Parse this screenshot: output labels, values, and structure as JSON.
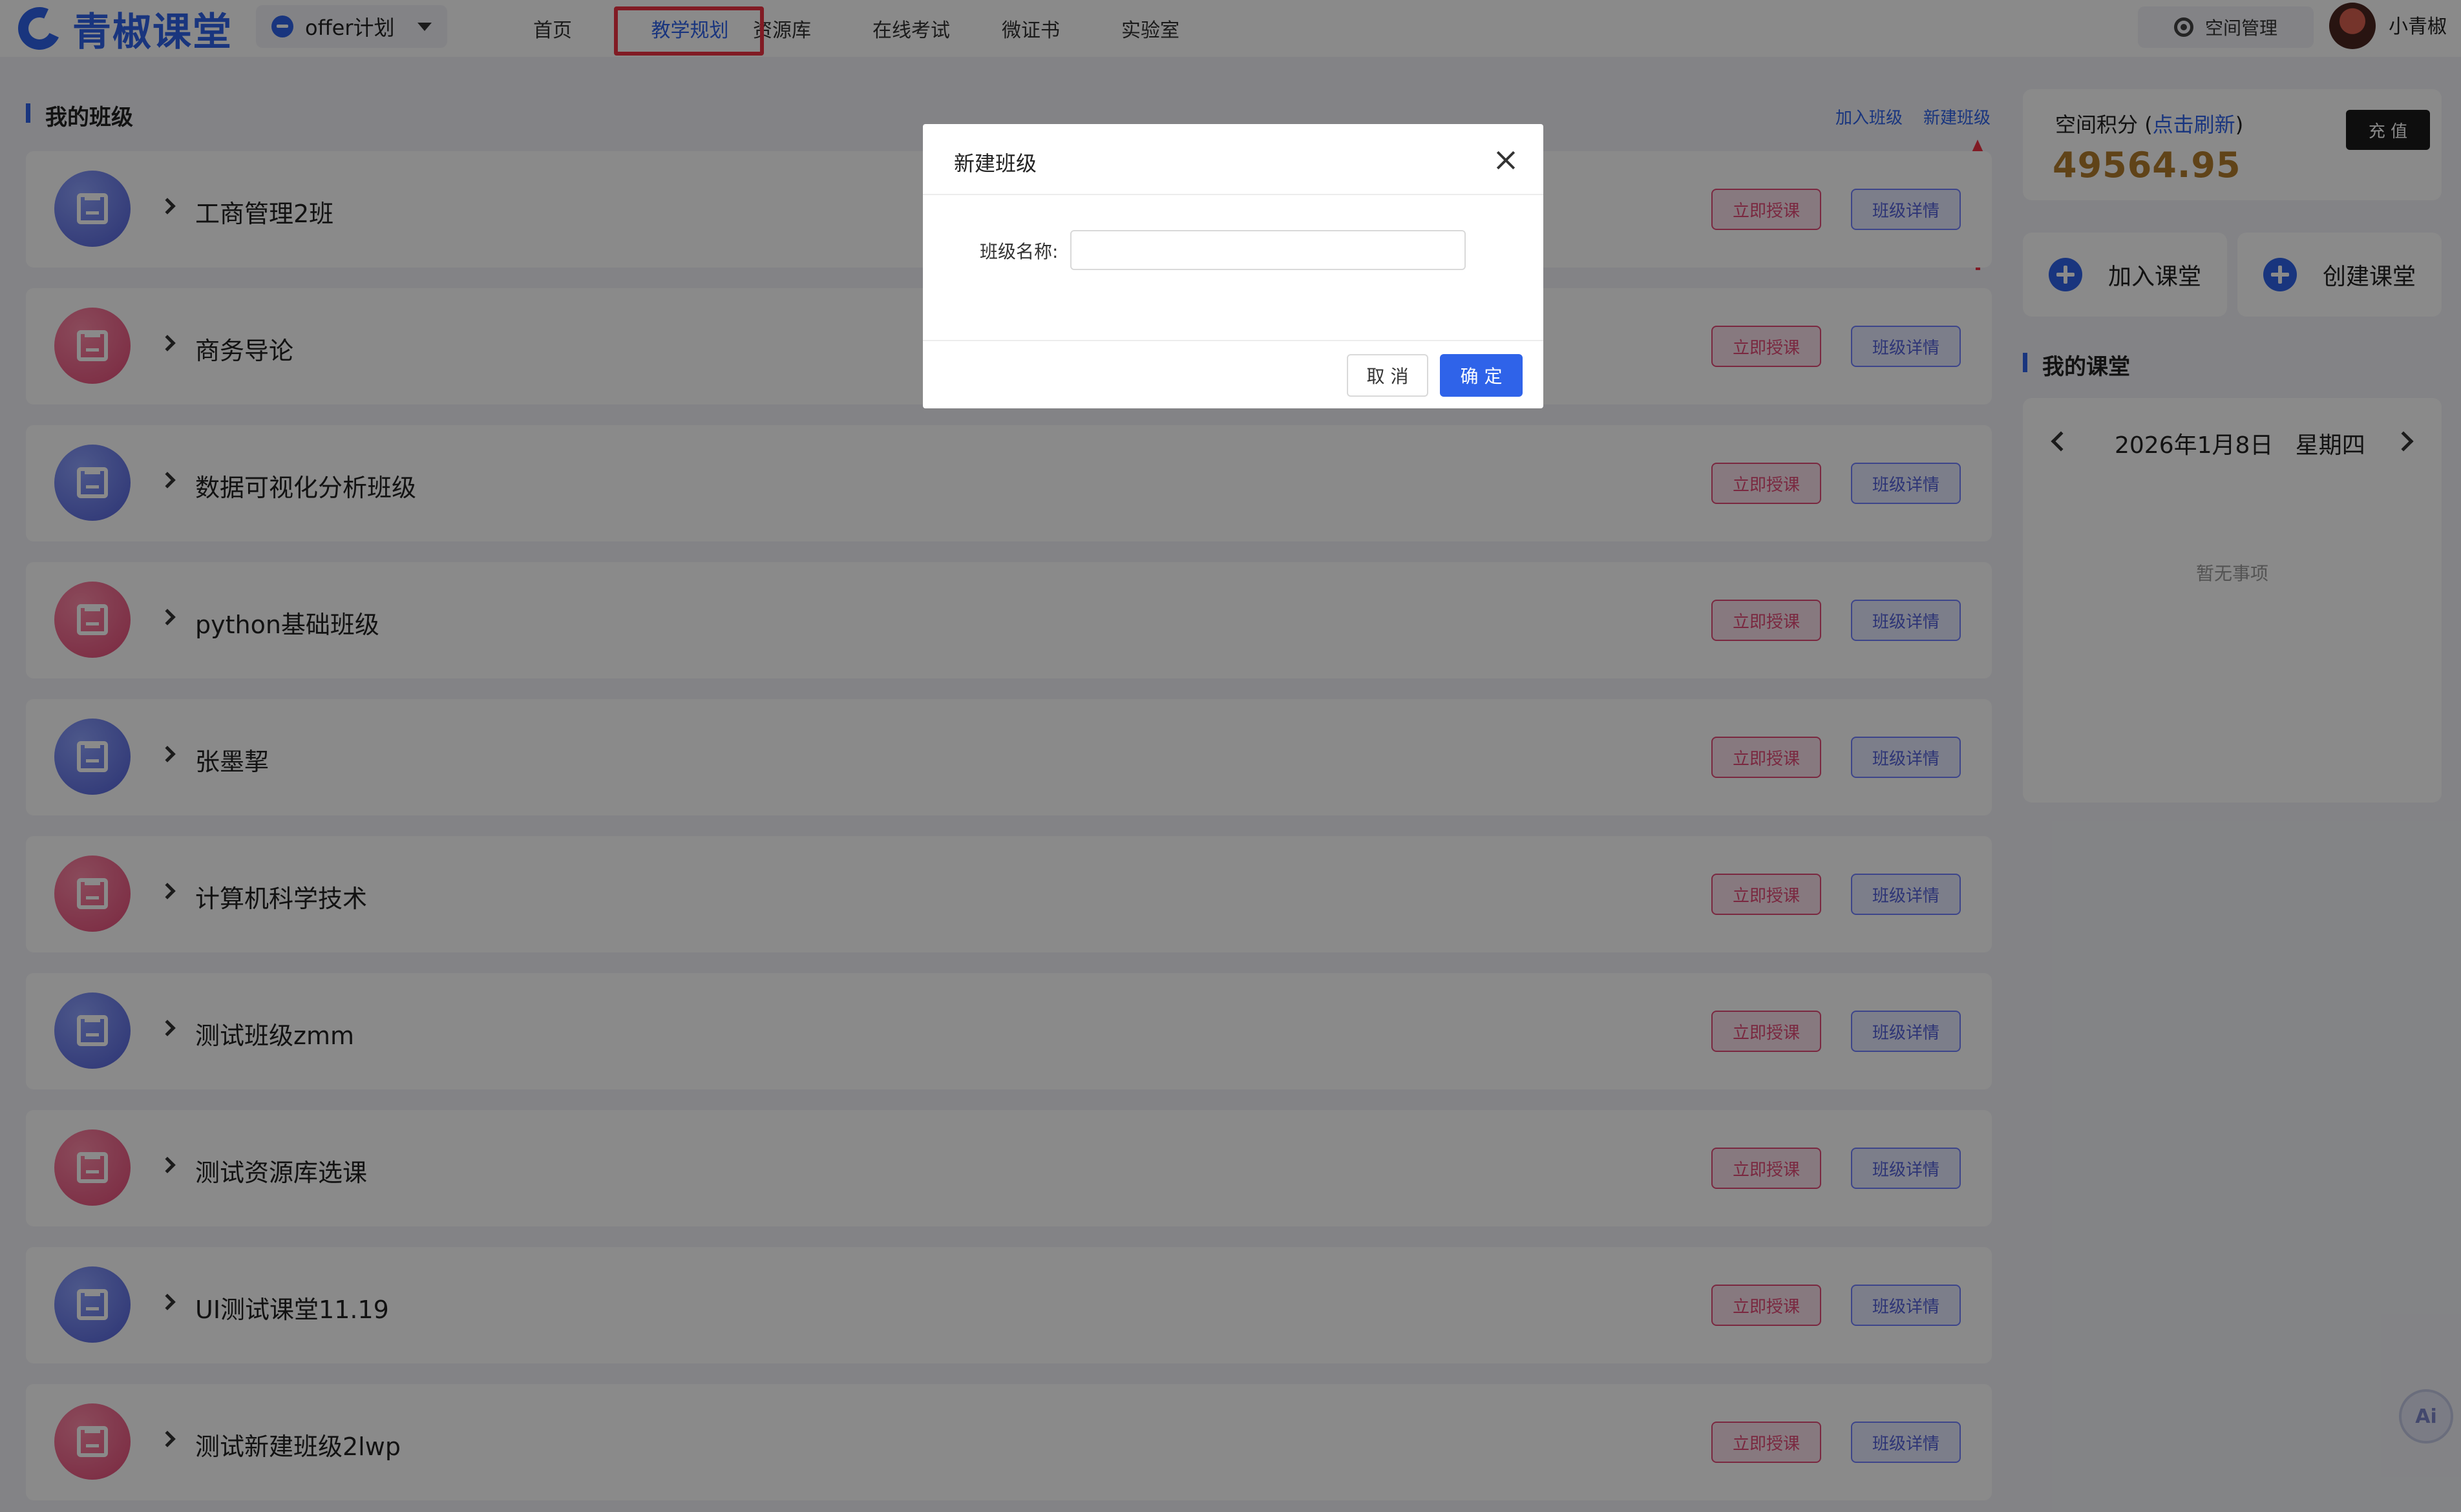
{
  "header": {
    "logo_text": "青椒课堂",
    "plan_selector": "offer计划",
    "nav": [
      "首页",
      "教学规划",
      "资源库",
      "在线考试",
      "微证书",
      "实验室"
    ],
    "active_nav": "教学规划",
    "space_management": "空间管理",
    "user_name": "小青椒"
  },
  "classes": {
    "title": "我的班级",
    "join_link": "加入班级",
    "create_link": "新建班级",
    "teach_button": "立即授课",
    "detail_button": "班级详情",
    "items": [
      {
        "name": "工商管理2班",
        "icon_color": "blue"
      },
      {
        "name": "商务导论",
        "icon_color": "pink"
      },
      {
        "name": "数据可视化分析班级",
        "icon_color": "blue"
      },
      {
        "name": "python基础班级",
        "icon_color": "pink"
      },
      {
        "name": "张墨挈",
        "icon_color": "blue"
      },
      {
        "name": "计算机科学技术",
        "icon_color": "pink"
      },
      {
        "name": "测试班级zmm",
        "icon_color": "blue"
      },
      {
        "name": "测试资源库选课",
        "icon_color": "pink"
      },
      {
        "name": "UI测试课堂11.19",
        "icon_color": "blue"
      },
      {
        "name": "测试新建班级2lwp",
        "icon_color": "pink"
      }
    ]
  },
  "sidebar": {
    "points_label": "空间积分",
    "points_refresh": "点击刷新",
    "points_value": "49564.95",
    "recharge_button": "充 值",
    "join_classroom": "加入课堂",
    "create_classroom": "创建课堂",
    "my_classroom_title": "我的课堂",
    "calendar_date": "2026年1月8日",
    "calendar_weekday": "星期四",
    "empty_state": "暂无事项",
    "ai_button": "Ai"
  },
  "modal": {
    "title": "新建班级",
    "field_label": "班级名称:",
    "input_value": "",
    "cancel_button": "取 消",
    "confirm_button": "确 定"
  }
}
